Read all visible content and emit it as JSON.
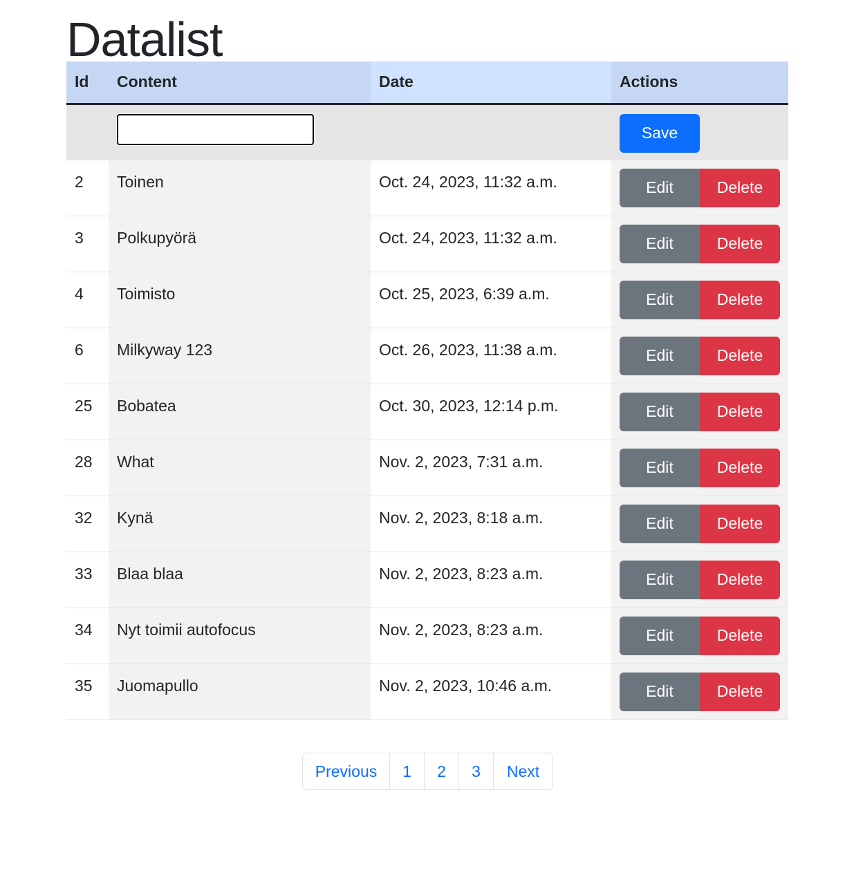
{
  "page": {
    "title": "Datalist"
  },
  "table": {
    "headers": {
      "id": "Id",
      "content": "Content",
      "date": "Date",
      "actions": "Actions"
    },
    "new_row": {
      "content_value": "",
      "save_label": "Save"
    },
    "rows": [
      {
        "id": "2",
        "content": "Toinen",
        "date": "Oct. 24, 2023, 11:32 a.m."
      },
      {
        "id": "3",
        "content": "Polkupyörä",
        "date": "Oct. 24, 2023, 11:32 a.m."
      },
      {
        "id": "4",
        "content": "Toimisto",
        "date": "Oct. 25, 2023, 6:39 a.m."
      },
      {
        "id": "6",
        "content": "Milkyway 123",
        "date": "Oct. 26, 2023, 11:38 a.m."
      },
      {
        "id": "25",
        "content": "Bobatea",
        "date": "Oct. 30, 2023, 12:14 p.m."
      },
      {
        "id": "28",
        "content": "What",
        "date": "Nov. 2, 2023, 7:31 a.m."
      },
      {
        "id": "32",
        "content": "Kynä",
        "date": "Nov. 2, 2023, 8:18 a.m."
      },
      {
        "id": "33",
        "content": "Blaa blaa",
        "date": "Nov. 2, 2023, 8:23 a.m."
      },
      {
        "id": "34",
        "content": "Nyt toimii autofocus",
        "date": "Nov. 2, 2023, 8:23 a.m."
      },
      {
        "id": "35",
        "content": "Juomapullo",
        "date": "Nov. 2, 2023, 10:46 a.m."
      }
    ],
    "row_actions": {
      "edit_label": "Edit",
      "delete_label": "Delete"
    }
  },
  "pagination": {
    "previous_label": "Previous",
    "pages": [
      "1",
      "2",
      "3"
    ],
    "next_label": "Next"
  },
  "colors": {
    "primary": "#0d6efd",
    "secondary": "#6c757d",
    "danger": "#dc3545",
    "header_bg": "#c5d7f2",
    "header_date_bg": "#cfe2ff"
  }
}
